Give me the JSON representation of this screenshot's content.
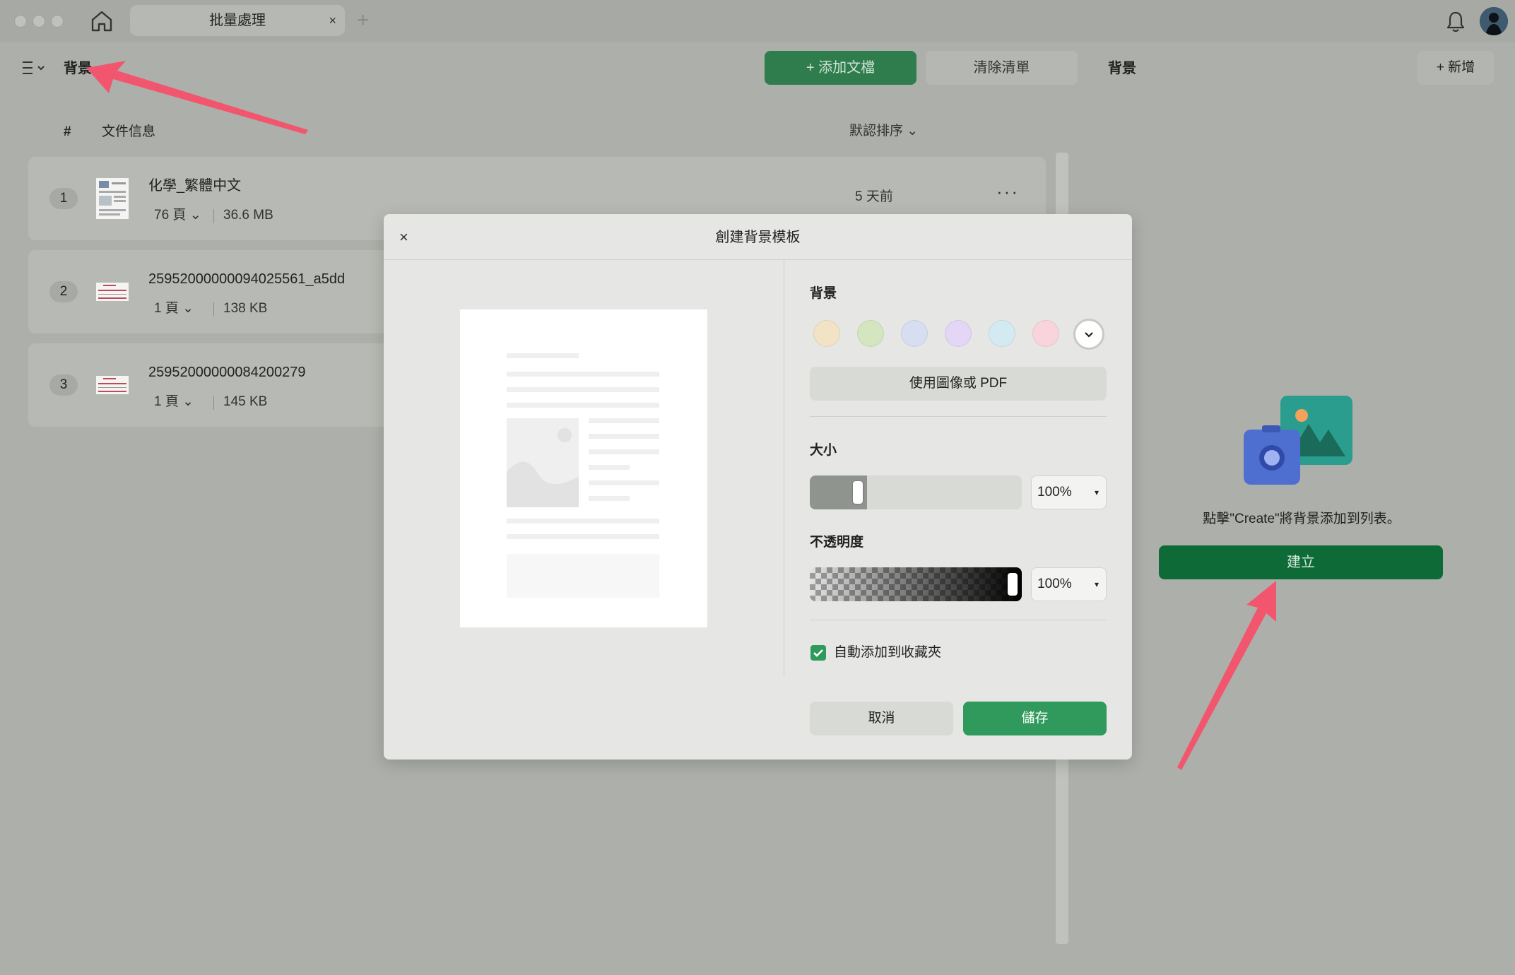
{
  "titlebar": {
    "tab_label": "批量處理",
    "tab_close": "×",
    "tab_add": "+"
  },
  "left_panel": {
    "title": "背景",
    "add_file_label": "+ 添加文檔",
    "clear_list_label": "清除清單",
    "col_hash": "#",
    "col_info": "文件信息",
    "sort_label": "默認排序 ⌄",
    "files": [
      {
        "num": "1",
        "name": "化學_繁體中文",
        "pages": "76 頁 ⌄",
        "size": "36.6 MB",
        "time": "5 天前",
        "more": "···"
      },
      {
        "num": "2",
        "name": "25952000000094025561_a5dd",
        "pages": "1 頁 ⌄",
        "size": "138 KB"
      },
      {
        "num": "3",
        "name": "25952000000084200279",
        "pages": "1 頁 ⌄",
        "size": "145 KB"
      }
    ]
  },
  "right_panel": {
    "title": "背景",
    "new_label": "+ 新增",
    "hint": "點擊\"Create\"將背景添加到列表。",
    "create_label": "建立"
  },
  "dialog": {
    "close": "×",
    "title": "創建背景模板",
    "background_label": "背景",
    "swatches": [
      "#f2e3c6",
      "#d3e6bf",
      "#d8def2",
      "#e3d6f6",
      "#d3eaf2",
      "#fad4dc"
    ],
    "swatch_more": "⌄",
    "use_image_label": "使用圖像或 PDF",
    "size_label": "大小",
    "size_value": "100%",
    "size_fraction": 0.2,
    "opacity_label": "不透明度",
    "opacity_value": "100%",
    "opacity_fraction": 1.0,
    "caret": "▾",
    "auto_add_label": "自動添加到收藏夾",
    "auto_add_checked": true,
    "cancel_label": "取消",
    "save_label": "儲存"
  },
  "colors": {
    "accent_green": "#2f9a5b",
    "dark_green": "#0e6a36",
    "annotation_arrow": "#f2566e"
  }
}
